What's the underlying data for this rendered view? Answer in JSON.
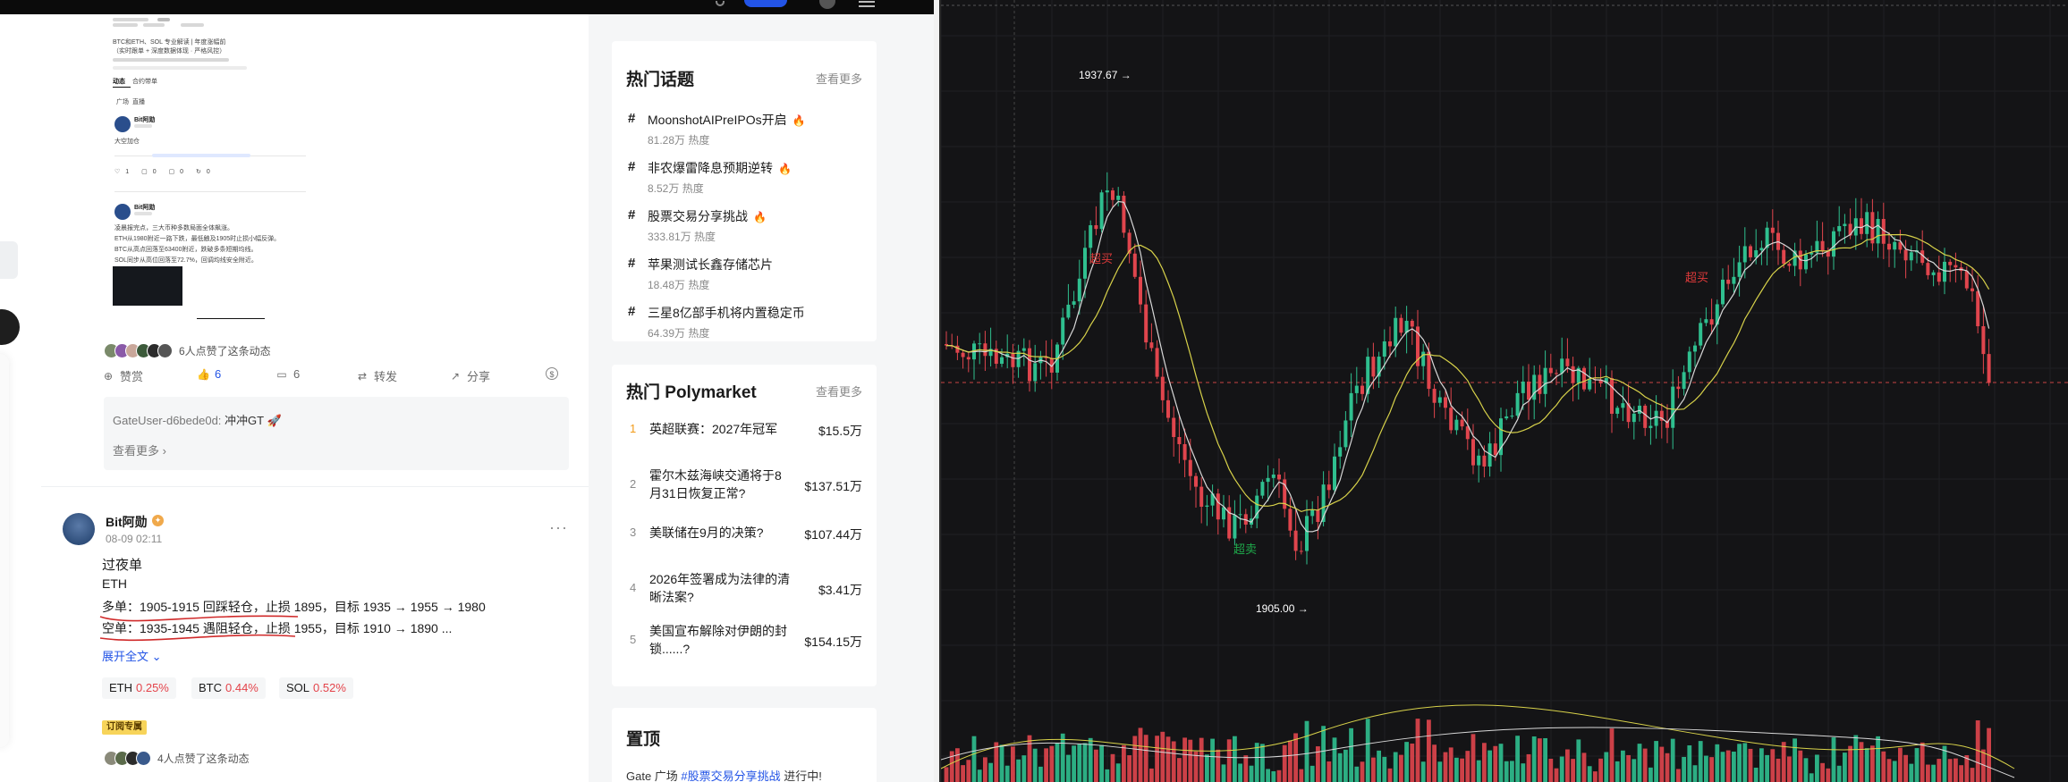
{
  "post1": {
    "likers_text": "6人点赞了这条动态",
    "actions": {
      "reward": "赞赏",
      "likes": "6",
      "comments": "6",
      "repost": "转发",
      "share": "分享"
    },
    "comment": {
      "user": "GateUser-d6bede0d:",
      "text": "冲冲GT",
      "emoji": "🚀",
      "view_more": "查看更多"
    },
    "thumbnail": {
      "meta_line_1": "BTC和ETH、SOL 专业解读 | 年度涨幅前",
      "meta_line_2": "（实时跟单 + 深度数据体现 · 严格风控）",
      "tab_1": "动态",
      "tab_2": "合约带单",
      "sub_tab_1": "广场",
      "sub_tab_2": "直播",
      "post_a_user": "Bit阿勋",
      "post_a_text": "大空加仓",
      "post_b_user": "Bit阿勋",
      "post_b_lines": [
        "凌晨报完点，三大币种多数局面全体飙涨。",
        "ETH从1980附近一路下跌，最低触及1905时止损小幅反弹。",
        "BTC从高点回落至63400附近，跌破多条短期均线。",
        "SOL同步从高位回落至72.7%，回调均线安全附近。"
      ]
    }
  },
  "post2": {
    "author": "Bit阿勋",
    "date": "08-09 02:11",
    "title": "过夜单",
    "asset": "ETH",
    "long_line": "多单：1905-1915 回踩轻仓，止损 1895，目标 1935 → 1955 → 1980",
    "short_line": "空单：1935-1945 遇阻轻仓，止损 1955，目标 1910 → 1890 ...",
    "expand": "展开全文",
    "tickers": [
      {
        "symbol": "ETH",
        "change": "0.25%"
      },
      {
        "symbol": "BTC",
        "change": "0.44%"
      },
      {
        "symbol": "SOL",
        "change": "0.52%"
      }
    ],
    "sub_badge": "订阅专属",
    "likers_text": "4人点赞了这条动态"
  },
  "hot_topics": {
    "title": "热门话题",
    "more": "查看更多",
    "items": [
      {
        "title": "MoonshotAIPreIPOs开启",
        "heat": "81.28万 热度",
        "hot": true
      },
      {
        "title": "非农爆雷降息预期逆转",
        "heat": "8.52万 热度",
        "hot": true
      },
      {
        "title": "股票交易分享挑战",
        "heat": "333.81万 热度",
        "hot": true
      },
      {
        "title": "苹果测试长鑫存储芯片",
        "heat": "18.48万 热度",
        "hot": false
      },
      {
        "title": "三星8亿部手机将内置稳定币",
        "heat": "64.39万 热度",
        "hot": false
      }
    ]
  },
  "polymarket": {
    "title": "热门 Polymarket",
    "more": "查看更多",
    "items": [
      {
        "rank": "1",
        "question": "英超联赛：2027年冠军",
        "value": "$15.5万"
      },
      {
        "rank": "2",
        "question": "霍尔木兹海峡交通将于8月31日恢复正常?",
        "value": "$137.51万"
      },
      {
        "rank": "3",
        "question": "美联储在9月的决策?",
        "value": "$107.44万"
      },
      {
        "rank": "4",
        "question": "2026年签署成为法律的清晰法案?",
        "value": "$3.41万"
      },
      {
        "rank": "5",
        "question": "美国宣布解除对伊朗的封锁......?",
        "value": "$154.15万"
      }
    ]
  },
  "pinned": {
    "title": "置顶",
    "text_prefix": "Gate 广场",
    "text_link": "#股票交易分享挑战",
    "text_suffix": "进行中!"
  },
  "chart": {
    "high_label": "1937.67",
    "low_label": "1905.00",
    "overbought_label": "超买",
    "oversold_label": "超卖",
    "colors": {
      "background": "#141416",
      "up": "#2fbf8f",
      "down": "#e0454d",
      "ma_fast": "#d8d8d8",
      "ma_slow": "#d8d24a",
      "overbought": "#e03a3a",
      "oversold": "#1ea84a",
      "crosshair": "#c94444"
    }
  }
}
